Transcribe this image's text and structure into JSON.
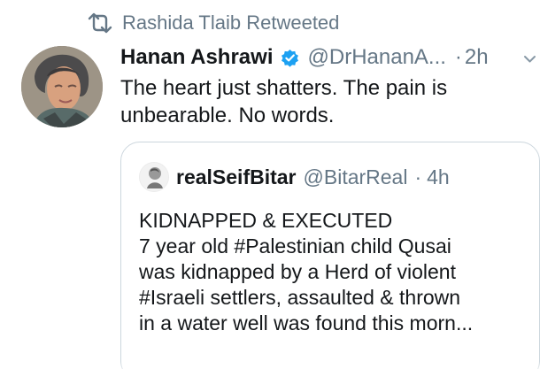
{
  "retweet": {
    "icon": "retweet-icon",
    "text": "Rashida Tlaib Retweeted"
  },
  "tweet": {
    "avatar_icon": "profile-photo",
    "display_name": "Hanan Ashrawi",
    "verified_icon": "verified-badge-icon",
    "handle": "@DrHananA...",
    "separator": "·",
    "time": "2h",
    "menu_icon": "chevron-down-icon",
    "text": "The heart just shatters. The pain is\nunbearable. No words."
  },
  "quote": {
    "avatar_icon": "quoted-profile-photo",
    "display_name": "realSeifBitar",
    "handle": "@BitarReal",
    "separator": "·",
    "time": "4h",
    "lines": [
      "KIDNAPPED & EXECUTED",
      "7 year old #Palestinian child Qusai",
      "was kidnapped by a Herd of violent",
      "#Israeli settlers, assaulted & thrown",
      "in a water well was found this morn..."
    ]
  },
  "colors": {
    "text": "#14171a",
    "muted": "#657786",
    "border": "#ccd6dd",
    "verified": "#1da1f2",
    "background": "#ffffff"
  }
}
